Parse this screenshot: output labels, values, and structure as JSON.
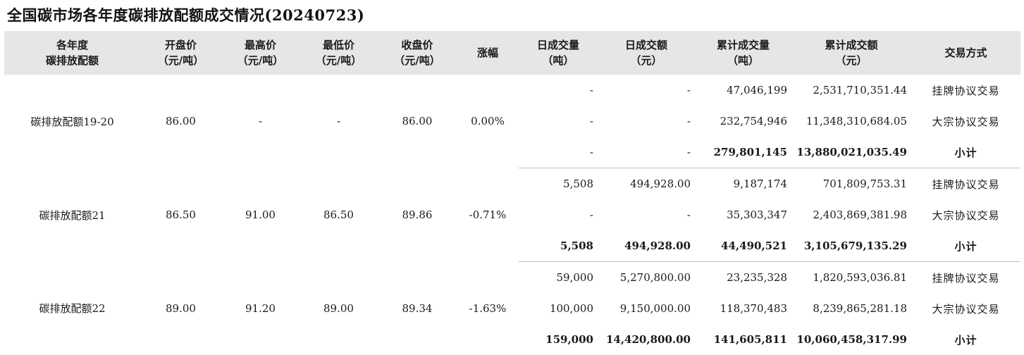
{
  "title": "全国碳市场各年度碳排放配额成交情况(20240723)",
  "headers": [
    {
      "l1": "各年度",
      "l2": "碳排放配额"
    },
    {
      "l1": "开盘价",
      "l2": "（元/吨）"
    },
    {
      "l1": "最高价",
      "l2": "（元/吨）"
    },
    {
      "l1": "最低价",
      "l2": "（元/吨）"
    },
    {
      "l1": "收盘价",
      "l2": "（元/吨）"
    },
    {
      "l1": "涨幅",
      "l2": ""
    },
    {
      "l1": "日成交量",
      "l2": "（吨）"
    },
    {
      "l1": "日成交额",
      "l2": "（元）"
    },
    {
      "l1": "累计成交量",
      "l2": "（吨）"
    },
    {
      "l1": "累计成交额",
      "l2": "（元）"
    },
    {
      "l1": "交易方式",
      "l2": ""
    }
  ],
  "groups": [
    {
      "name": "碳排放配额19-20",
      "open": "86.00",
      "high": "-",
      "low": "-",
      "close": "86.00",
      "change": "0.00%",
      "rows": [
        {
          "day_vol": "-",
          "day_amt": "-",
          "cum_vol": "47,046,199",
          "cum_amt": "2,531,710,351.44",
          "method": "挂牌协议交易"
        },
        {
          "day_vol": "-",
          "day_amt": "-",
          "cum_vol": "232,754,946",
          "cum_amt": "11,348,310,684.05",
          "method": "大宗协议交易"
        },
        {
          "day_vol": "-",
          "day_amt": "-",
          "cum_vol": "279,801,145",
          "cum_amt": "13,880,021,035.49",
          "method": "小计"
        }
      ]
    },
    {
      "name": "碳排放配额21",
      "open": "86.50",
      "high": "91.00",
      "low": "86.50",
      "close": "89.86",
      "change": "-0.71%",
      "rows": [
        {
          "day_vol": "5,508",
          "day_amt": "494,928.00",
          "cum_vol": "9,187,174",
          "cum_amt": "701,809,753.31",
          "method": "挂牌协议交易"
        },
        {
          "day_vol": "-",
          "day_amt": "-",
          "cum_vol": "35,303,347",
          "cum_amt": "2,403,869,381.98",
          "method": "大宗协议交易"
        },
        {
          "day_vol": "5,508",
          "day_amt": "494,928.00",
          "cum_vol": "44,490,521",
          "cum_amt": "3,105,679,135.29",
          "method": "小计"
        }
      ]
    },
    {
      "name": "碳排放配额22",
      "open": "89.00",
      "high": "91.20",
      "low": "89.00",
      "close": "89.34",
      "change": "-1.63%",
      "rows": [
        {
          "day_vol": "59,000",
          "day_amt": "5,270,800.00",
          "cum_vol": "23,235,328",
          "cum_amt": "1,820,593,036.81",
          "method": "挂牌协议交易"
        },
        {
          "day_vol": "100,000",
          "day_amt": "9,150,000.00",
          "cum_vol": "118,370,483",
          "cum_amt": "8,239,865,281.18",
          "method": "大宗协议交易"
        },
        {
          "day_vol": "159,000",
          "day_amt": "14,420,800.00",
          "cum_vol": "141,605,811",
          "cum_amt": "10,060,458,317.99",
          "method": "小计"
        }
      ]
    }
  ]
}
